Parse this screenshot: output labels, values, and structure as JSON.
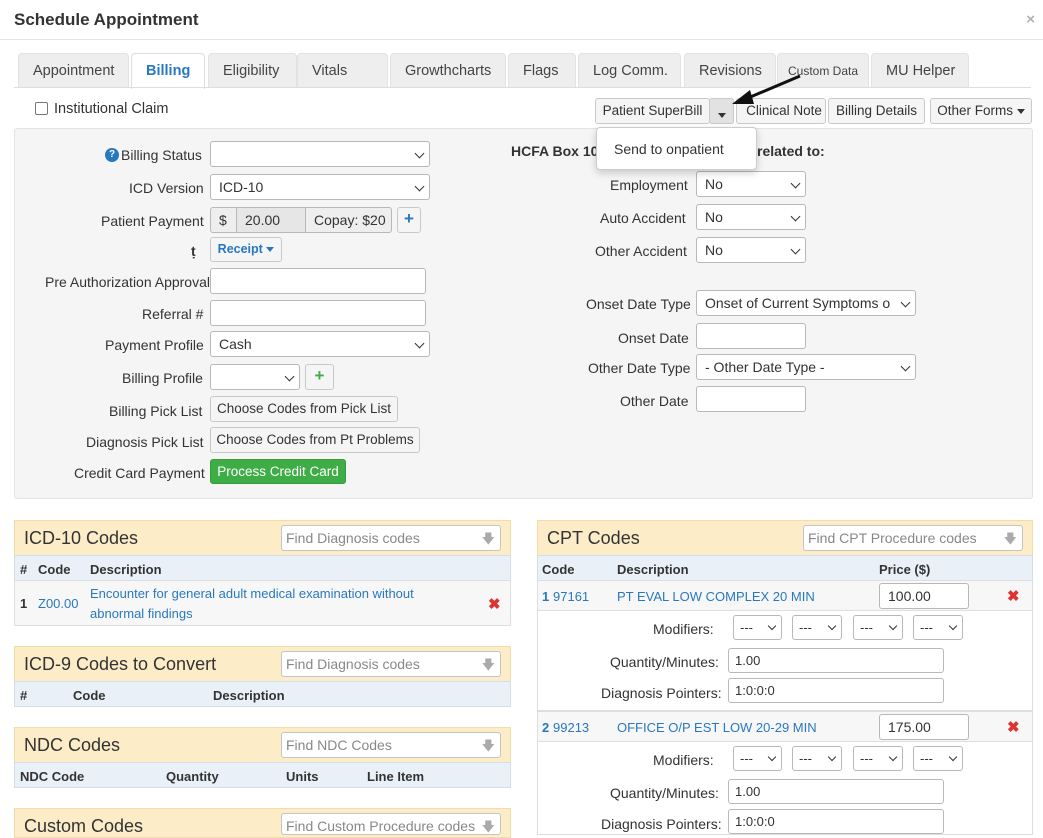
{
  "header": {
    "title": "Schedule Appointment",
    "close_label": "×"
  },
  "tabs": [
    {
      "label": "Appointment"
    },
    {
      "label": "Billing"
    },
    {
      "label": "Eligibility"
    },
    {
      "label": "Vitals"
    },
    {
      "label": "Growthcharts"
    },
    {
      "label": "Flags"
    },
    {
      "label": "Log Comm."
    },
    {
      "label": "Revisions"
    },
    {
      "label": "Custom Data"
    },
    {
      "label": "MU Helper"
    }
  ],
  "toolbar": {
    "institutional_claim": "Institutional Claim",
    "patient_superbill": "Patient SuperBill",
    "clinical_note": "Clinical Note",
    "billing_details": "Billing Details",
    "other_forms": "Other Forms"
  },
  "superbill_menu": {
    "send_to_onpatient": "Send to onpatient"
  },
  "form": {
    "billing_status": {
      "label": "Billing Status",
      "value": ""
    },
    "icd_version": {
      "label": "ICD Version",
      "value": "ICD-10"
    },
    "patient_payment": {
      "label": "Patient Payment",
      "currency": "$",
      "value": "20.00",
      "copay": "Copay: $20"
    },
    "receipt_label": "Receipt",
    "pre_auth": {
      "label": "Pre Authorization Approval",
      "value": ""
    },
    "referral": {
      "label": "Referral #",
      "value": ""
    },
    "payment_profile": {
      "label": "Payment Profile",
      "value": "Cash"
    },
    "billing_profile": {
      "label": "Billing Profile",
      "value": ""
    },
    "billing_pick_list": {
      "label": "Billing Pick List",
      "button": "Choose Codes from Pick List"
    },
    "diagnosis_pick_list": {
      "label": "Diagnosis Pick List",
      "button": "Choose Codes from Pt Problems"
    },
    "credit_card": {
      "label": "Credit Card Payment",
      "button": "Process Credit Card"
    }
  },
  "hcfa": {
    "heading_left": "HCFA Box 10",
    "heading_right": "related to:",
    "employment": {
      "label": "Employment",
      "value": "No"
    },
    "auto_accident": {
      "label": "Auto Accident",
      "value": "No"
    },
    "other_accident": {
      "label": "Other Accident",
      "value": "No"
    },
    "onset_date_type": {
      "label": "Onset Date Type",
      "value": "Onset of Current Symptoms o"
    },
    "onset_date": {
      "label": "Onset Date",
      "value": ""
    },
    "other_date_type": {
      "label": "Other Date Type",
      "value": "- Other Date Type -"
    },
    "other_date": {
      "label": "Other Date",
      "value": ""
    }
  },
  "icd10": {
    "title": "ICD-10 Codes",
    "search_placeholder": "Find Diagnosis codes",
    "columns": [
      "#",
      "Code",
      "Description"
    ],
    "rows": [
      {
        "num": "1",
        "code": "Z00.00",
        "desc1": "Encounter for general adult medical examination without",
        "desc2": "abnormal findings"
      }
    ]
  },
  "icd9": {
    "title": "ICD-9 Codes to Convert",
    "search_placeholder": "Find Diagnosis codes",
    "columns": [
      "#",
      "Code",
      "Description"
    ]
  },
  "ndc": {
    "title": "NDC Codes",
    "search_placeholder": "Find NDC Codes",
    "columns": [
      "NDC Code",
      "Quantity",
      "Units",
      "Line Item"
    ]
  },
  "custom": {
    "title": "Custom Codes",
    "search_placeholder": "Find Custom Procedure codes"
  },
  "cpt": {
    "title": "CPT Codes",
    "search_placeholder": "Find CPT Procedure codes",
    "columns": [
      "Code",
      "Description",
      "Price ($)"
    ],
    "modifiers_label": "Modifiers:",
    "quantity_label": "Quantity/Minutes:",
    "pointers_label": "Diagnosis Pointers:",
    "modifier_value": "---",
    "rows": [
      {
        "num": "1",
        "code": "97161",
        "desc": "PT EVAL LOW COMPLEX 20 MIN",
        "price": "100.00",
        "quantity": "1.00",
        "pointers": "1:0:0:0"
      },
      {
        "num": "2",
        "code": "99213",
        "desc": "OFFICE O/P EST LOW 20-29 MIN",
        "price": "175.00",
        "quantity": "1.00",
        "pointers": "1:0:0:0"
      }
    ]
  },
  "icons": {
    "help": "question-circle-icon",
    "close": "close-icon",
    "delete": "delete-x-icon",
    "add": "plus-icon",
    "arrow": "annotation-arrow-icon"
  },
  "colors": {
    "accent": "#2878c0",
    "section_header": "#fcedc8",
    "table_header": "#e9f0f8",
    "success": "#3fad46",
    "danger": "#dd3333"
  }
}
